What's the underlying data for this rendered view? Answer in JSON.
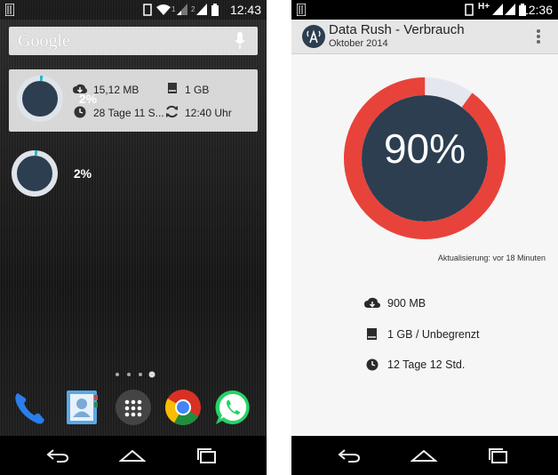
{
  "left_screen": {
    "status_bar": {
      "time": "12:43",
      "sim1": "1",
      "sim2": "2"
    },
    "search": {
      "logo_text": "Google"
    },
    "widget": {
      "ring_percent": "2%",
      "used_data": "15,12 MB",
      "limit": "1 GB",
      "remaining": "28 Tage 11 S...",
      "last_update": "12:40 Uhr"
    },
    "small_widget": {
      "ring_percent": "2%"
    },
    "page_indicator": {
      "count": 4,
      "active_index": 3
    },
    "dock": [
      "phone-icon",
      "contacts-icon",
      "app-drawer-icon",
      "chrome-icon",
      "whatsapp-icon"
    ]
  },
  "right_screen": {
    "status_bar": {
      "time": "12:36",
      "network": "H+"
    },
    "app_bar": {
      "title": "Data Rush - Verbrauch",
      "subtitle": "Oktober 2014"
    },
    "usage": {
      "percent_label": "90%",
      "percent_value": 90
    },
    "update": {
      "label": "Aktualisierung:",
      "value": "vor 18 Minuten"
    },
    "stats": {
      "used": "900 MB",
      "limit": "1 GB / Unbegrenzt",
      "remaining": "12 Tage 12 Std."
    }
  },
  "colors": {
    "ring_red": "#e8433a",
    "ring_dark": "#2c3e50",
    "ring_track": "#e4e8ee",
    "widget_ring": "#2c3e50",
    "widget_ring_track": "#dfe4ea",
    "widget_ring_accent": "#29b6c8"
  }
}
